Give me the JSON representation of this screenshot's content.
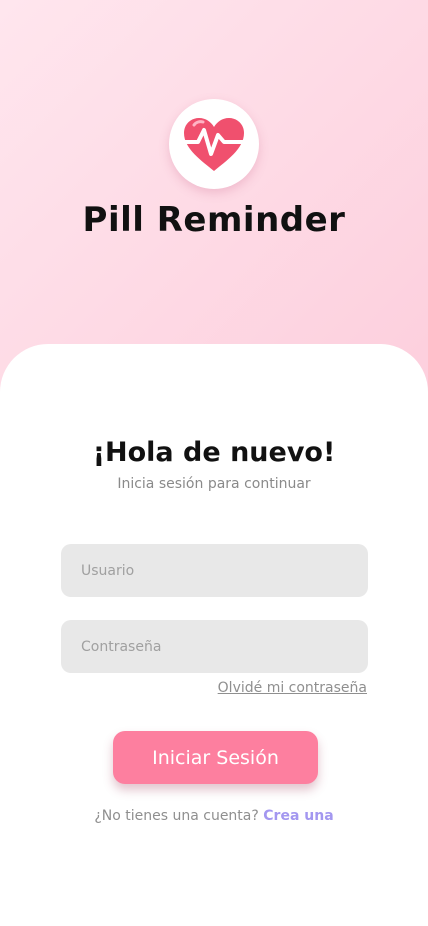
{
  "app": {
    "title": "Pill Reminder"
  },
  "login": {
    "greeting": "¡Hola de nuevo!",
    "subtitle": "Inicia sesión para continuar",
    "username_placeholder": "Usuario",
    "username_value": "",
    "password_placeholder": "Contraseña",
    "password_value": "",
    "forgot_label": "Olvidé mi contraseña",
    "submit_label": "Iniciar Sesión",
    "no_account_text": "¿No tienes una cuenta?",
    "signup_label": "Crea una"
  },
  "icons": {
    "logo": "heart-pulse-icon"
  },
  "colors": {
    "accent": "#fd7f9f",
    "link": "#a397f0",
    "heart": "#f0506e",
    "background_top": "#ffe6ee",
    "background_bottom": "#fcc0d4"
  }
}
